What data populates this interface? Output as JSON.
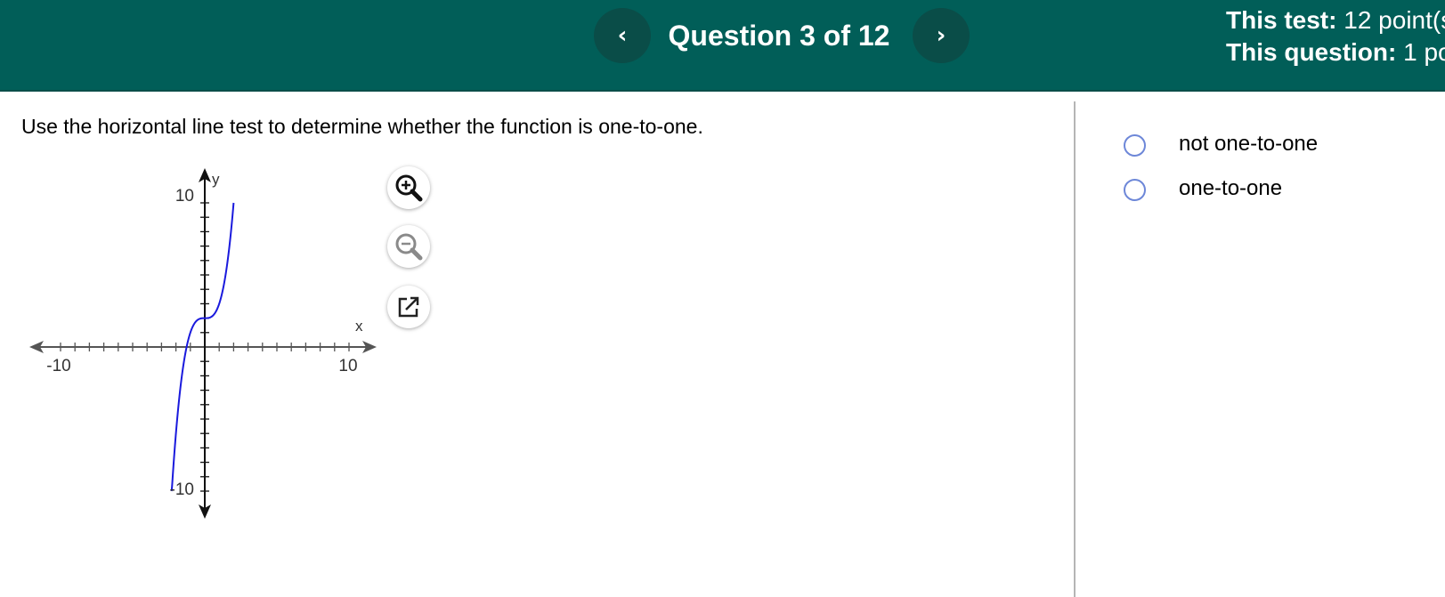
{
  "header": {
    "prev_label": "‹",
    "next_label": "›",
    "question_title": "Question 3 of 12",
    "this_test_label": "This test:",
    "this_test_value": "12 point(s",
    "this_question_label": "This question:",
    "this_question_value": "1 po"
  },
  "question": {
    "prompt": "Use the horizontal line test to determine whether the function is one-to-one."
  },
  "graph": {
    "x_axis_label": "x",
    "y_axis_label": "y",
    "x_min_label": "-10",
    "x_max_label": "10",
    "y_max_label": "10",
    "y_min_label": "-10",
    "curve_color": "#1a1add",
    "axis_color": "#555555"
  },
  "chart_data": {
    "type": "line",
    "xlim": [
      -10,
      10
    ],
    "ylim": [
      -10,
      10
    ],
    "xlabel": "x",
    "ylabel": "y",
    "x_ticks": [
      "-10",
      "10"
    ],
    "y_ticks": [
      "10",
      "-10"
    ],
    "series": [
      {
        "x": [
          -2.3,
          -2.0,
          -1.5,
          -1.0,
          -0.5,
          0.0,
          0.5,
          1.0,
          1.5,
          2.0
        ],
        "y": [
          -10,
          -6.5,
          -2.4,
          0.8,
          1.96,
          2.0,
          2.04,
          3.2,
          6.4,
          10.0
        ]
      }
    ],
    "grid": false
  },
  "tools": {
    "zoom_in_icon": "zoom-in-icon",
    "zoom_out_icon": "zoom-out-icon",
    "popout_icon": "popout-icon"
  },
  "answers": {
    "options": [
      {
        "label": "not one-to-one"
      },
      {
        "label": "one-to-one"
      }
    ]
  },
  "colors": {
    "header_bg": "#015e58",
    "nav_button_bg": "#0a4d48",
    "radio_border": "#6d87d8",
    "divider": "#b5b5b5"
  }
}
